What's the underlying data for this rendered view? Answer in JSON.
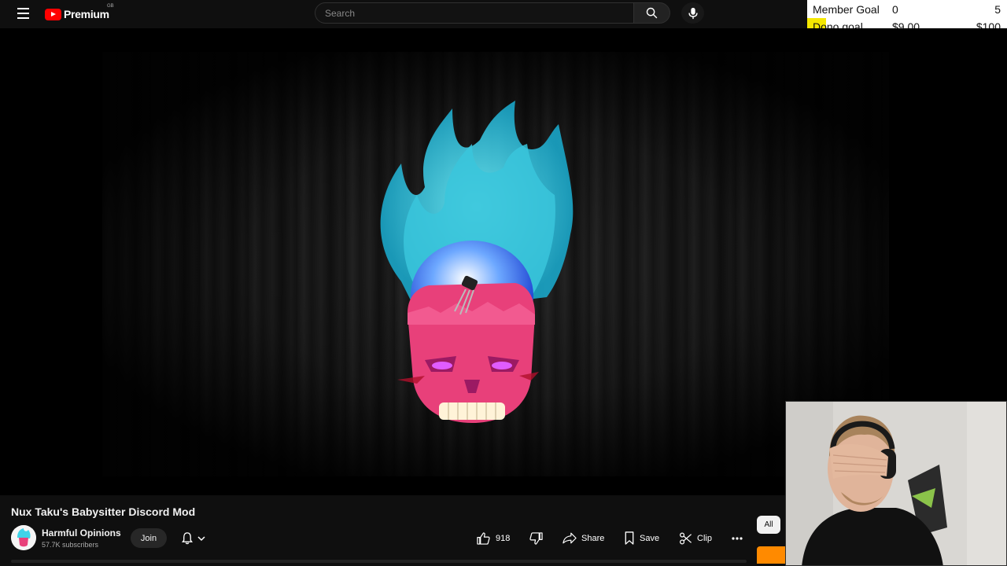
{
  "header": {
    "logo_text": "Premium",
    "region": "GB",
    "search_placeholder": "Search"
  },
  "goals": {
    "member": {
      "label": "Member Goal",
      "current": "0",
      "target": "5"
    },
    "dono": {
      "label": "Dono goal",
      "current": "$9.00",
      "target": "$100"
    },
    "highlight_color": "#f5e800"
  },
  "video": {
    "title": "Nux Taku's Babysitter Discord Mod"
  },
  "channel": {
    "name": "Harmful Opinions",
    "subscribers": "57.7K subscribers",
    "join_label": "Join"
  },
  "actions": {
    "like_count": "918",
    "share_label": "Share",
    "save_label": "Save",
    "clip_label": "Clip"
  },
  "chips": {
    "all_label": "All"
  },
  "colors": {
    "brand": "#ff0000",
    "flame": "#3fd3e8",
    "skull": "#e8407a",
    "orange_chip": "#ff8a00"
  }
}
